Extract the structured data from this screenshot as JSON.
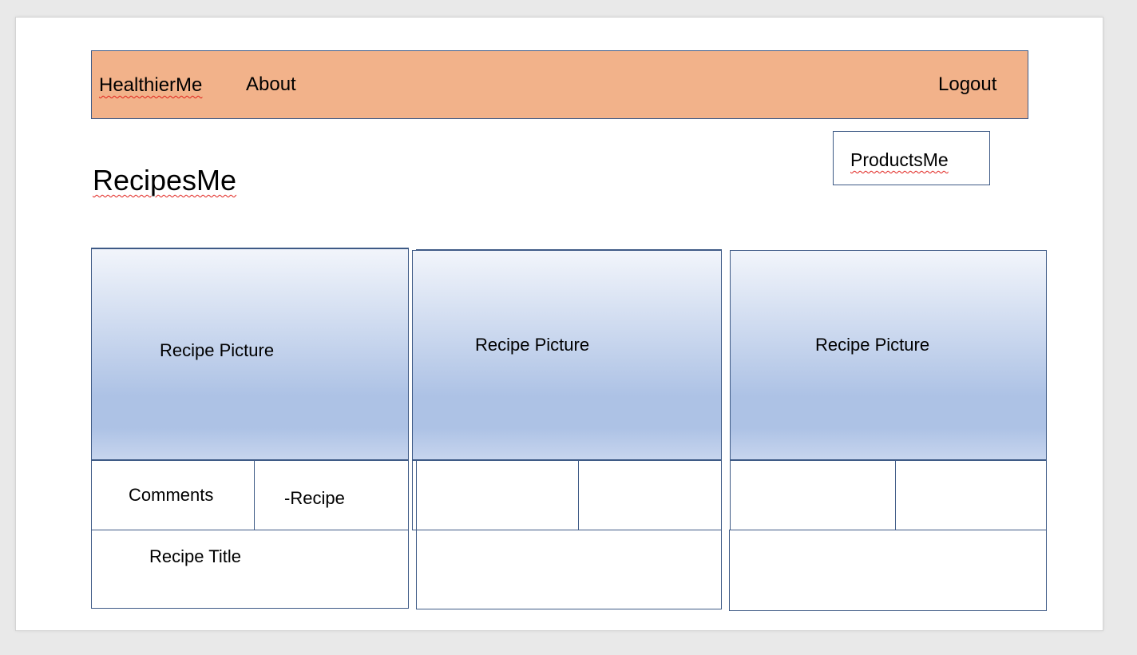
{
  "colors": {
    "navbar_bg": "#f2b28a",
    "border": "#3e5a86",
    "picture_gradient_top": "#f2f5fb",
    "picture_gradient_mid": "#adc2e5",
    "picture_gradient_bottom": "#c7d5ee",
    "spellcheck_underline": "#e0201a"
  },
  "navbar": {
    "brand": "HealthierMe",
    "about": "About",
    "logout": "Logout"
  },
  "products_link": "ProductsMe",
  "page_title": "RecipesMe",
  "cards": [
    {
      "picture_label": "Recipe Picture",
      "comments_label": "Comments",
      "recipe_label": "-Recipe",
      "title_label": "Recipe Title"
    },
    {
      "picture_label": "Recipe Picture",
      "comments_label": "",
      "recipe_label": "",
      "title_label": ""
    },
    {
      "picture_label": "Recipe Picture",
      "comments_label": "",
      "recipe_label": "",
      "title_label": ""
    }
  ]
}
